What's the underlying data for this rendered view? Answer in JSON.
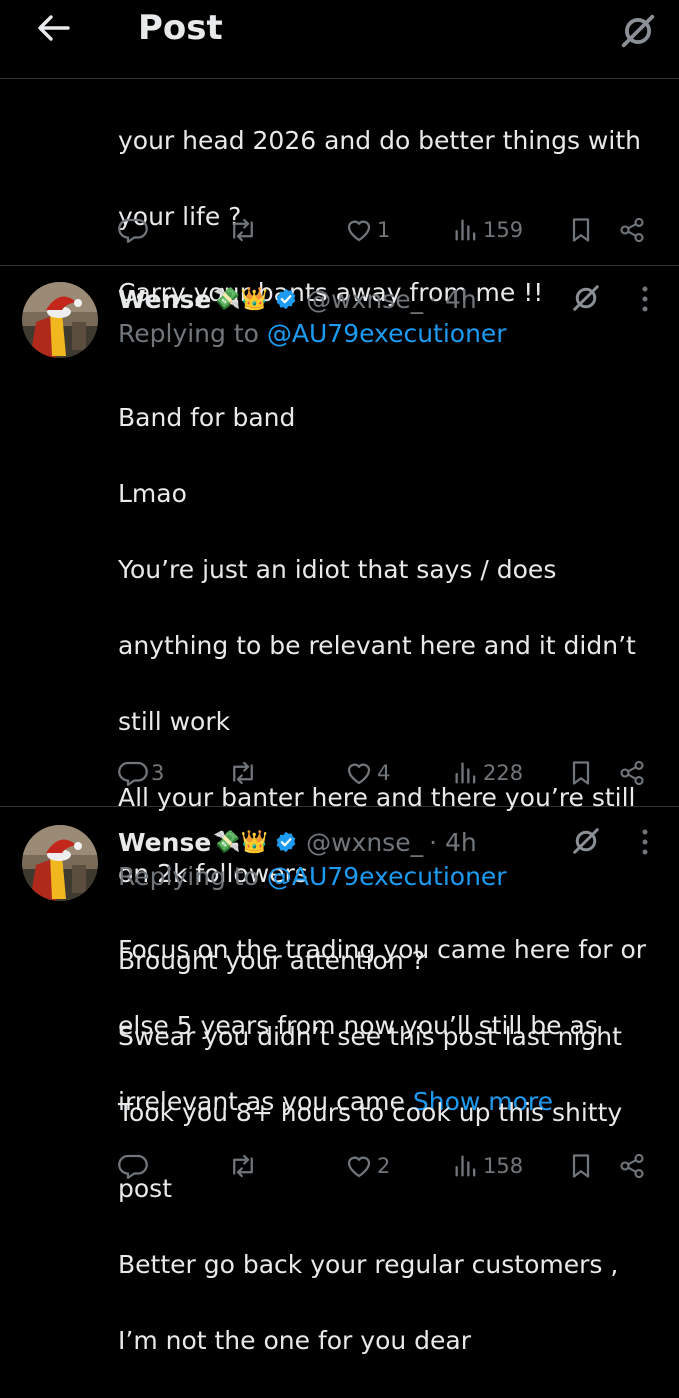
{
  "header": {
    "title": "Post"
  },
  "colors": {
    "background": "#000000",
    "text": "#e7e9ea",
    "muted": "#71767b",
    "accent": "#1d9bf0",
    "divider": "#2f3336"
  },
  "icons": [
    "back-arrow-icon",
    "grok-icon",
    "reply-icon",
    "retweet-icon",
    "like-icon",
    "views-icon",
    "bookmark-icon",
    "share-icon",
    "verified-badge-icon",
    "more-icon"
  ],
  "tweet1": {
    "lines": [
      "your head 2026 and do better things with",
      "your life ?",
      "Carry your bants away from me !!"
    ],
    "replies": "",
    "retweets": "",
    "likes": "1",
    "views": "159"
  },
  "tweet2": {
    "name": "Wense",
    "emojis": "💸👑",
    "handle": "@wxnse_",
    "time": "· 4h",
    "replying_prefix": "Replying to ",
    "replying_to": "@AU79executioner",
    "lines": [
      "Band for band",
      "Lmao",
      "You’re just an idiot that says / does",
      "anything to be relevant here and it didn’t",
      "still work",
      "All your banter here and there you’re still",
      "on 2k followers",
      "Focus on the trading you came here for or",
      "else 5 years from now you’ll still be as"
    ],
    "last_line": "irrelevant as you came ",
    "show_more": "Show more",
    "replies": "3",
    "retweets": "",
    "likes": "4",
    "views": "228"
  },
  "tweet3": {
    "name": "Wense",
    "emojis": "💸👑",
    "handle": "@wxnse_",
    "time": "· 4h",
    "replying_prefix": "Replying to ",
    "replying_to": "@AU79executioner",
    "lines": [
      "Brought your attention ?",
      "Swear you didn’t see this post last night",
      "Took you 8+ hours to cook up this shitty",
      "post",
      "Better go back your regular customers ,",
      "I’m not the one for you dear"
    ],
    "replies": "",
    "retweets": "",
    "likes": "2",
    "views": "158"
  }
}
